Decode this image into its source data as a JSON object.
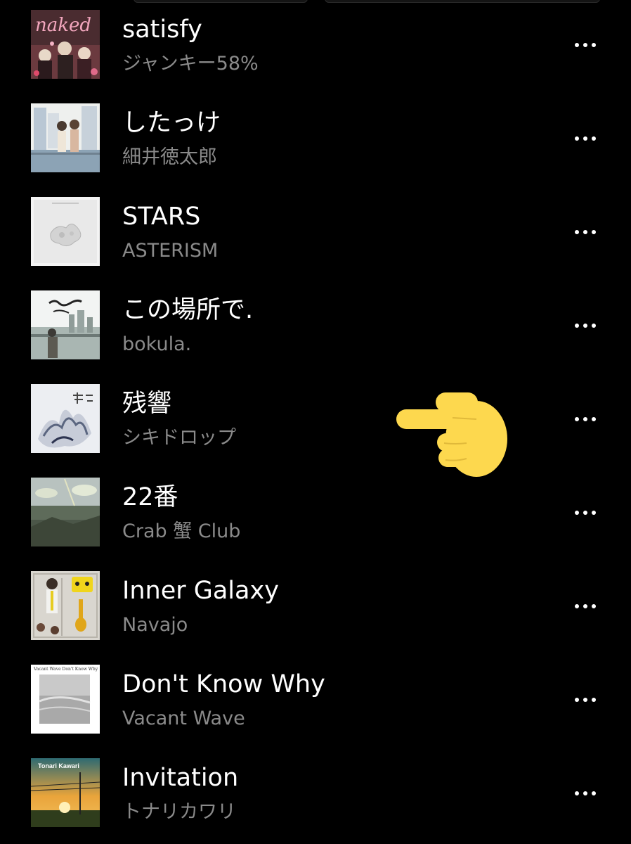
{
  "tracks": [
    {
      "title": "satisfy",
      "artist": "ジャンキー58%",
      "art_icon": "album-art-naked",
      "art_text": "naked"
    },
    {
      "title": "したっけ",
      "artist": "細井徳太郎",
      "art_icon": "album-art-illustration"
    },
    {
      "title": "STARS",
      "artist": "ASTERISM",
      "art_icon": "album-art-white-relief"
    },
    {
      "title": "この場所で.",
      "artist": "bokula.",
      "art_icon": "album-art-bokula"
    },
    {
      "title": "残響",
      "artist": "シキドロップ",
      "art_icon": "album-art-zankyo"
    },
    {
      "title": "22番",
      "artist": "Crab 蟹 Club",
      "art_icon": "album-art-landscape"
    },
    {
      "title": "Inner Galaxy",
      "artist": "Navajo",
      "art_icon": "album-art-model-kit"
    },
    {
      "title": "Don't Know Why",
      "artist": "Vacant Wave",
      "art_icon": "album-art-vacant-wave",
      "art_text": "Vacant Wave Don't Know Why"
    },
    {
      "title": "Invitation",
      "artist": "トナリカワリ",
      "art_icon": "album-art-sunset",
      "art_text": "Tonari Kawari"
    }
  ],
  "overlay": {
    "icon": "pointing-hand-icon",
    "color": "#fdd84e"
  },
  "colors": {
    "background": "#000000",
    "title": "#ffffff",
    "artist": "#8a8a8a"
  }
}
